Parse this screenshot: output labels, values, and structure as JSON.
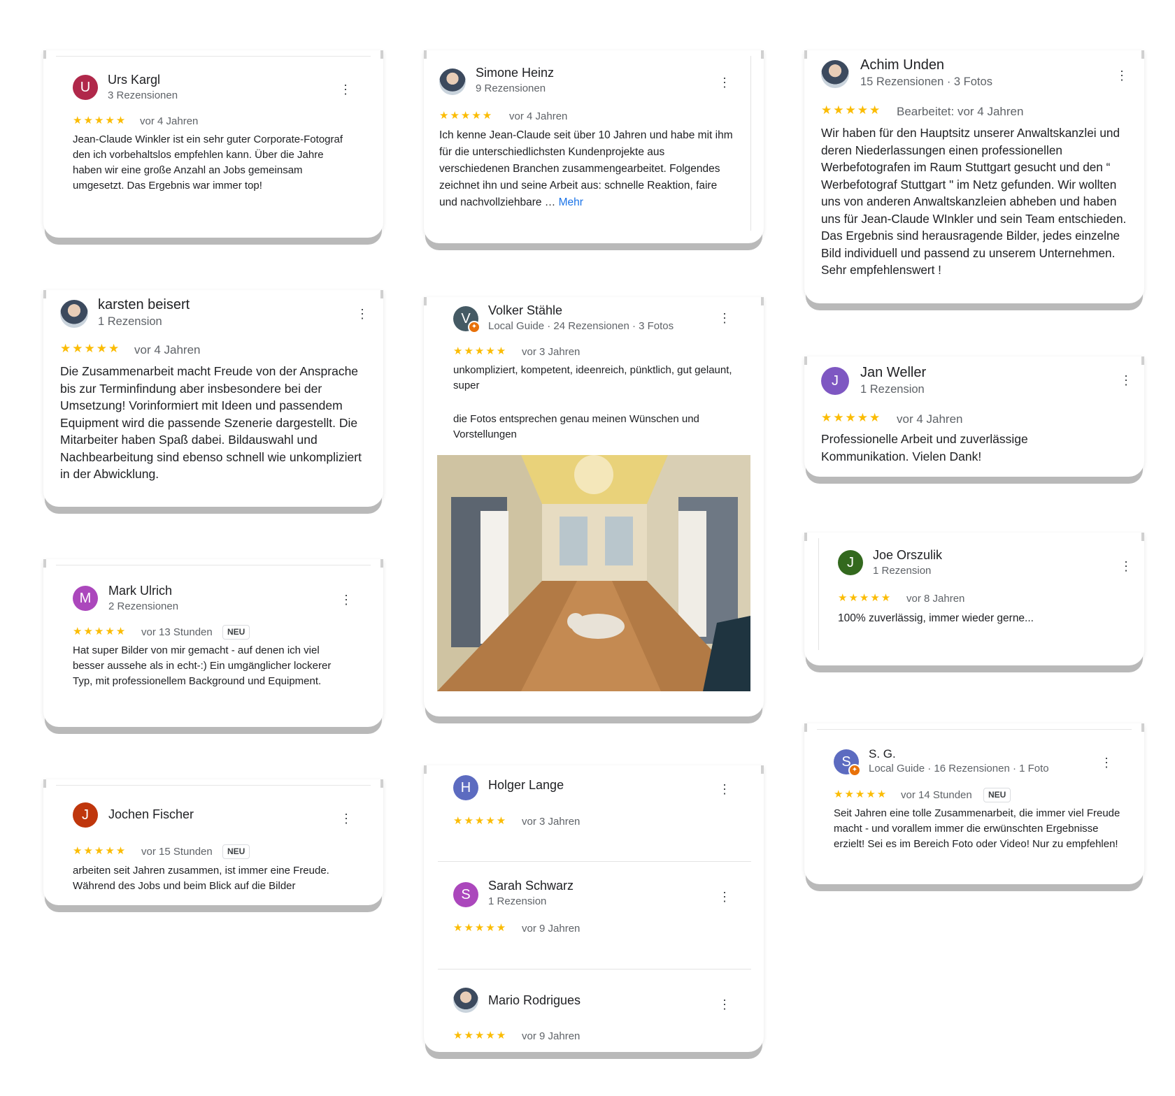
{
  "reviews": {
    "urs": {
      "initial": "U",
      "name": "Urs Kargl",
      "meta": "3 Rezensionen",
      "stars": "★★★★★",
      "when": "vor 4 Jahren",
      "text": "Jean-Claude Winkler ist ein sehr guter Corporate-Fotograf den ich vorbehaltslos empfehlen kann. Über die Jahre haben wir eine große Anzahl an Jobs gemeinsam umgesetzt. Das Ergebnis war immer top!",
      "color": "#b0284a"
    },
    "simone": {
      "name": "Simone Heinz",
      "meta": "9 Rezensionen",
      "stars": "★★★★★",
      "when": "vor 4 Jahren",
      "text": "Ich kenne Jean-Claude seit über 10 Jahren und habe mit ihm für die unterschiedlichsten Kundenprojekte aus verschiedenen Branchen zusammengearbeitet. Folgendes zeichnet ihn und seine Arbeit aus: schnelle Reaktion, faire und nachvollziehbare …",
      "more": "Mehr"
    },
    "achim": {
      "name": "Achim Unden",
      "meta": "15 Rezensionen · 3 Fotos",
      "stars": "★★★★★",
      "when": "Bearbeitet: vor 4 Jahren",
      "text": "Wir haben für den Hauptsitz unserer Anwaltskanzlei und deren Niederlassungen einen professionellen Werbefotografen im Raum Stuttgart gesucht und den “ Werbefotograf Stuttgart \" im Netz gefunden. Wir wollten uns von anderen Anwaltskanzleien abheben und haben uns für Jean-Claude WInkler und sein Team entschieden. Das Ergebnis sind herausragende Bilder, jedes einzelne Bild individuell und passend zu unserem Unternehmen. Sehr empfehlenswert !"
    },
    "karsten": {
      "name": "karsten beisert",
      "meta": "1 Rezension",
      "stars": "★★★★★",
      "when": "vor 4 Jahren",
      "text": "Die Zusammenarbeit macht Freude von der Ansprache bis zur Terminfindung aber insbesondere bei der Umsetzung! Vorinformiert mit Ideen und passendem Equipment wird die passende Szenerie dargestellt. Die Mitarbeiter haben Spaß dabei. Bildauswahl und Nachbearbeitung sind ebenso schnell wie unkompliziert in der Abwicklung."
    },
    "volker": {
      "initial": "V",
      "name": "Volker Stähle",
      "meta": "Local Guide · 24 Rezensionen · 3 Fotos",
      "stars": "★★★★★",
      "when": "vor 3 Jahren",
      "text1": "unkompliziert, kompetent, ideenreich, pünktlich, gut gelaunt, super",
      "text2": "die Fotos entsprechen genau meinen Wünschen und Vorstellungen",
      "color": "#455a64"
    },
    "jan": {
      "initial": "J",
      "name": "Jan Weller",
      "meta": "1 Rezension",
      "stars": "★★★★★",
      "when": "vor 4 Jahren",
      "text": "Professionelle Arbeit  und zuverlässige Kommunikation. Vielen Dank!",
      "color": "#7e57c2"
    },
    "mark": {
      "initial": "M",
      "name": "Mark Ulrich",
      "meta": "2 Rezensionen",
      "stars": "★★★★★",
      "when": "vor 13 Stunden",
      "neu": "NEU",
      "text": "Hat super Bilder von mir gemacht - auf denen ich viel besser aussehe als in echt-:) Ein umgänglicher lockerer Typ, mit professionellem Background und Equipment.",
      "color": "#ab47bc"
    },
    "joe": {
      "initial": "J",
      "name": "Joe Orszulik",
      "meta": "1 Rezension",
      "stars": "★★★★★",
      "when": "vor 8 Jahren",
      "text": "100% zuverlässig, immer wieder gerne...",
      "color": "#33691e"
    },
    "jochen": {
      "initial": "J",
      "name": "Jochen Fischer",
      "stars": "★★★★★",
      "when": "vor 15 Stunden",
      "neu": "NEU",
      "text": "arbeiten seit Jahren zusammen, ist immer eine Freude. Während des Jobs und beim Blick auf die Bilder",
      "color": "#bf360c"
    },
    "holger": {
      "initial": "H",
      "name": "Holger Lange",
      "stars": "★★★★★",
      "when": "vor 3 Jahren",
      "color": "#5c6bc0"
    },
    "sarah": {
      "initial": "S",
      "name": "Sarah Schwarz",
      "meta": "1 Rezension",
      "stars": "★★★★★",
      "when": "vor 9 Jahren",
      "color": "#ab47bc"
    },
    "mario": {
      "name": "Mario Rodrigues",
      "stars": "★★★★★",
      "when": "vor 9 Jahren"
    },
    "sg": {
      "initial": "S",
      "name": "S. G.",
      "meta": "Local Guide · 16 Rezensionen · 1 Foto",
      "stars": "★★★★★",
      "when": "vor 14 Stunden",
      "neu": "NEU",
      "text": "Seit Jahren eine tolle Zusammenarbeit, die immer viel Freude macht - und vorallem immer die erwünschten Ergebnisse erzielt! Sei es im Bereich Foto oder Video! Nur zu empfehlen!",
      "color": "#5c6bc0"
    }
  },
  "icons": {
    "more": "⋮",
    "guide": "✦"
  }
}
